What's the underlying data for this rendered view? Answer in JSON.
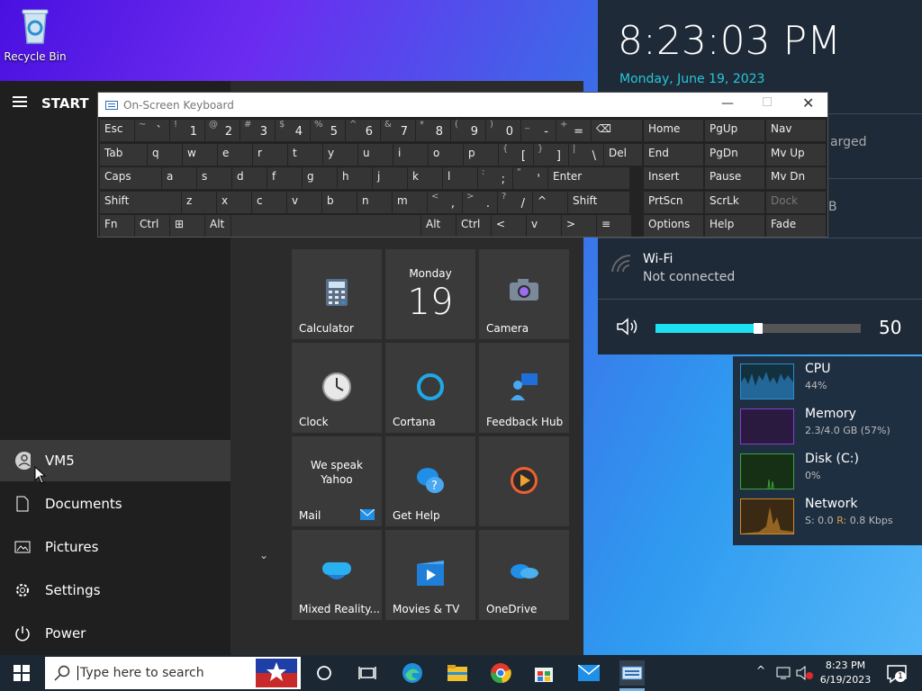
{
  "desktop": {
    "recycle_bin": "Recycle Bin"
  },
  "start_menu": {
    "header": "START",
    "user": "VM5",
    "items": [
      "Documents",
      "Pictures",
      "Settings",
      "Power"
    ]
  },
  "tiles": [
    {
      "label": "Calculator",
      "icon": "calculator-icon"
    },
    {
      "label": "Clock",
      "icon": "clock-icon"
    },
    {
      "label": "Cortana",
      "icon": "cortana-icon"
    },
    {
      "label": "Feedback Hub",
      "icon": "feedback-hub-icon"
    },
    {
      "label": "Mail",
      "icon": "mail-icon",
      "text": "We speak Yahoo"
    },
    {
      "label": "Get Help",
      "icon": "get-help-icon"
    },
    {
      "label": "Mixed Reality...",
      "icon": "mixed-reality-icon"
    },
    {
      "label": "Movies & TV",
      "icon": "movies-icon"
    },
    {
      "label": "OneDrive",
      "icon": "onedrive-icon"
    },
    {
      "label": "Camera",
      "icon": "camera-icon"
    }
  ],
  "calendar_tile": {
    "weekday": "Monday",
    "day": "19"
  },
  "osk": {
    "title": "On-Screen Keyboard",
    "row1": [
      "Esc",
      "~ `",
      "! 1",
      "@ 2",
      "# 3",
      "$ 4",
      "% 5",
      "^ 6",
      "& 7",
      "* 8",
      "( 9",
      ") 0",
      "_ -",
      "+ =",
      "⌫"
    ],
    "row2": [
      "Tab",
      "q",
      "w",
      "e",
      "r",
      "t",
      "y",
      "u",
      "i",
      "o",
      "p",
      "{ [",
      "} ]",
      "| \\",
      "Del"
    ],
    "row3": [
      "Caps",
      "a",
      "s",
      "d",
      "f",
      "g",
      "h",
      "j",
      "k",
      "l",
      ": ;",
      "\" '",
      "Enter"
    ],
    "row4": [
      "Shift",
      "z",
      "x",
      "c",
      "v",
      "b",
      "n",
      "m",
      "< ,",
      "> .",
      "? /",
      "^",
      "Shift"
    ],
    "row5": [
      "Fn",
      "Ctrl",
      "⊞",
      "Alt",
      "",
      "Alt",
      "Ctrl",
      "<",
      "v",
      ">",
      "≡"
    ],
    "nav": [
      [
        "Home",
        "PgUp",
        "Nav"
      ],
      [
        "End",
        "PgDn",
        "Mv Up"
      ],
      [
        "Insert",
        "Pause",
        "Mv Dn"
      ],
      [
        "PrtScn",
        "ScrLk",
        "Dock"
      ],
      [
        "Options",
        "Help",
        "Fade"
      ]
    ]
  },
  "info": {
    "time": "8:23:03 PM",
    "date": "Monday, June 19, 2023",
    "partial1": "arged",
    "partial2": "B",
    "wifi_title": "Wi-Fi",
    "wifi_status": "Not connected",
    "volume": 50,
    "volume_label": "50"
  },
  "meters": [
    {
      "name": "CPU",
      "value": "44%",
      "color": "#2a8fcf"
    },
    {
      "name": "Memory",
      "value": "2.3/4.0 GB (57%)",
      "color": "#8a3ccf"
    },
    {
      "name": "Disk (C:)",
      "value": "0%",
      "color": "#3ca43c"
    },
    {
      "name": "Network",
      "value_s": "S: 0.0",
      "value_r": "R:",
      "value_tail": "0.8 Kbps",
      "color": "#cf8a2a"
    }
  ],
  "taskbar": {
    "search_placeholder": "Type here to search",
    "time": "8:23 PM",
    "date": "6/19/2023",
    "notifications": "1"
  }
}
